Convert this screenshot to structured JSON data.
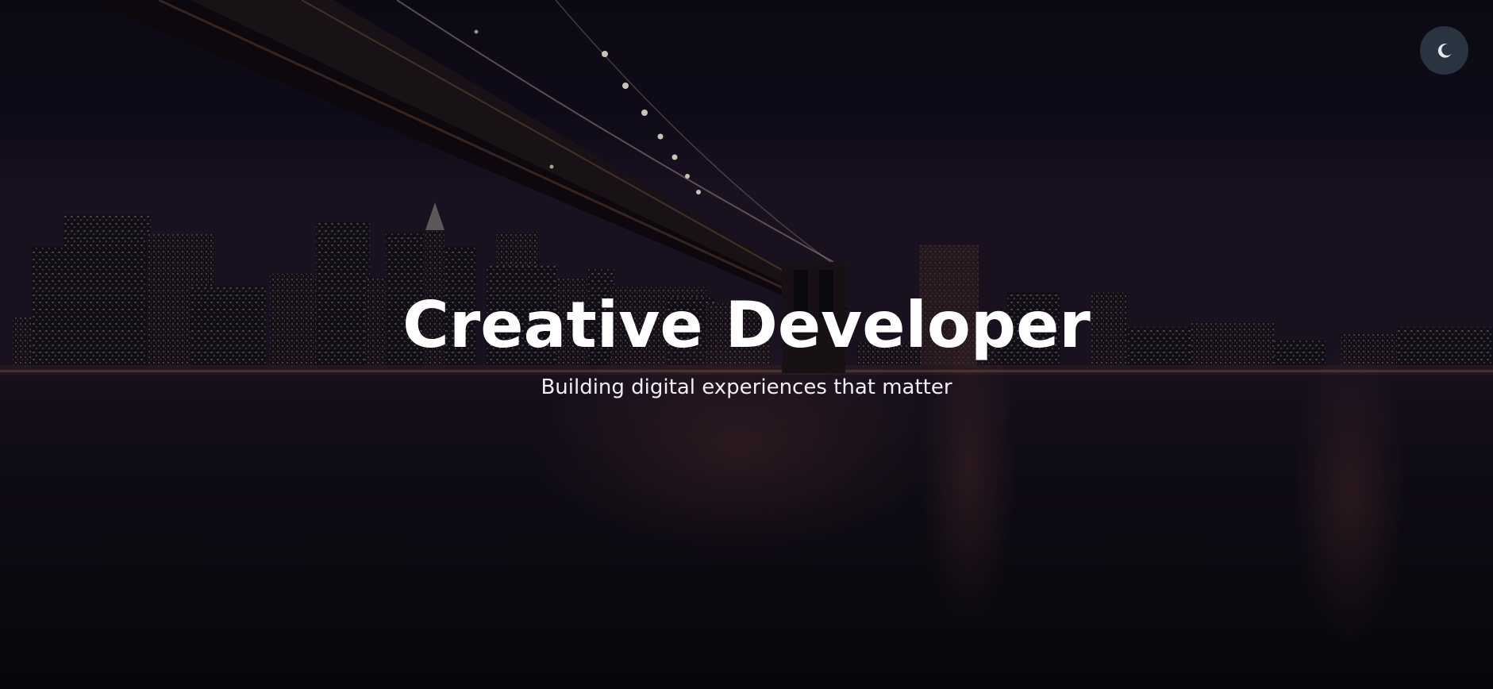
{
  "hero": {
    "title": "Creative Developer",
    "subtitle": "Building digital experiences that matter"
  },
  "theme_toggle": {
    "icon": "moon-icon"
  },
  "colors": {
    "toggle_bg": "#2a3340",
    "toggle_icon": "#e6e8ee",
    "text": "#ffffff",
    "sky": "#0f0b18",
    "water": "#0b0910"
  }
}
